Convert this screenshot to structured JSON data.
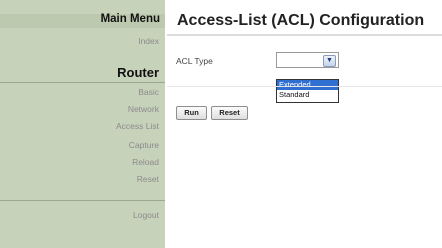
{
  "sidebar": {
    "menu_title": "Main Menu",
    "index_link": "Index",
    "router_title": "Router",
    "items": [
      {
        "label": "Basic"
      },
      {
        "label": "Network"
      },
      {
        "label": "Access List"
      },
      {
        "label": "Capture"
      },
      {
        "label": "Reload"
      },
      {
        "label": "Reset"
      }
    ],
    "logout": "Logout"
  },
  "main": {
    "title": "Access-List (ACL) Configuration",
    "acl_type_label": "ACL Type",
    "select": {
      "value": "",
      "options": [
        {
          "label": "Extended",
          "selected": true
        },
        {
          "label": "Standard",
          "selected": false
        }
      ]
    },
    "buttons": {
      "run": "Run",
      "reset": "Reset"
    }
  },
  "colors": {
    "sidebar_bg": "#c7d2bb",
    "highlight": "#2f6fd1"
  },
  "icons": {
    "select_arrow": "chevron-down-icon"
  }
}
